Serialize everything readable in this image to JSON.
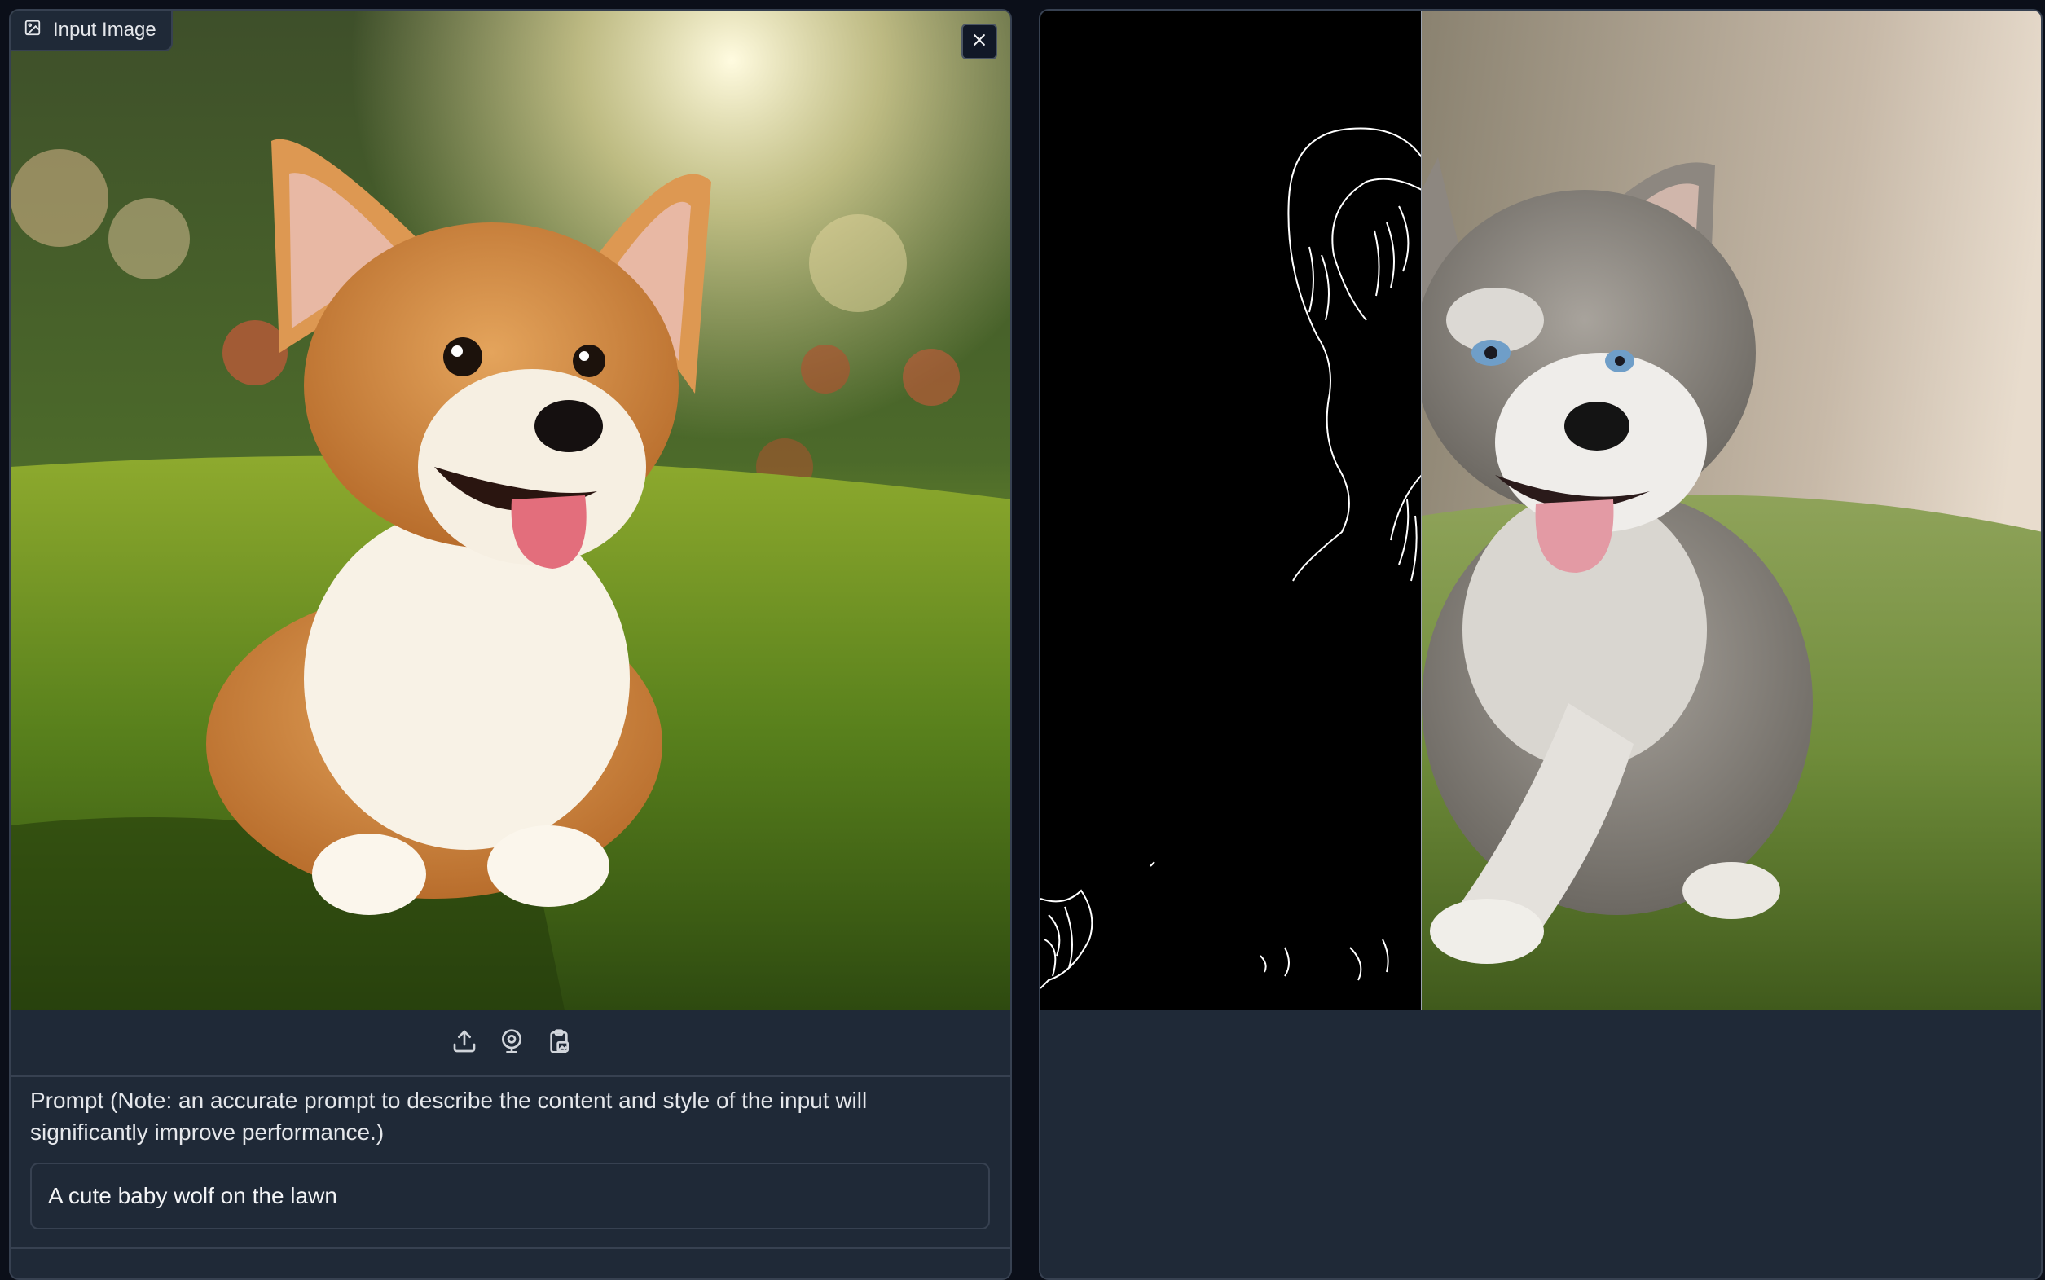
{
  "input_panel": {
    "label": "Input Image",
    "label_icon": "image-icon",
    "close_icon": "close-icon",
    "toolbar": [
      {
        "name": "upload-button",
        "icon": "upload-icon"
      },
      {
        "name": "webcam-button",
        "icon": "webcam-icon"
      },
      {
        "name": "paste-clipboard-button",
        "icon": "clipboard-icon"
      }
    ]
  },
  "prompt": {
    "label": "Prompt (Note: an accurate prompt to describe the content and style of the input will significantly improve performance.)",
    "value": "A cute baby wolf on the lawn"
  },
  "colors": {
    "page_bg": "#0b0f19",
    "panel_bg": "#1f2937",
    "border": "#374151",
    "text": "#e5e7eb"
  }
}
